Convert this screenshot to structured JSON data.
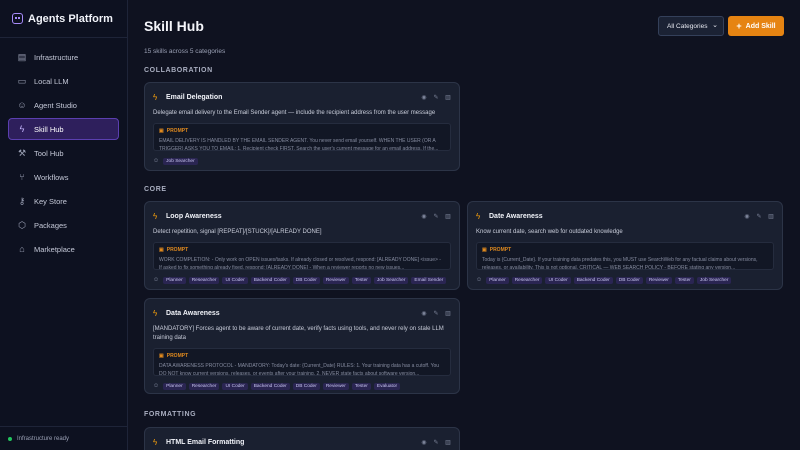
{
  "app": {
    "title": "Agents Platform"
  },
  "sidebar": {
    "items": [
      {
        "label": "Infrastructure",
        "icon": "server-icon"
      },
      {
        "label": "Local LLM",
        "icon": "monitor-icon"
      },
      {
        "label": "Agent Studio",
        "icon": "robot-icon"
      },
      {
        "label": "Skill Hub",
        "icon": "bolt-icon",
        "active": true
      },
      {
        "label": "Tool Hub",
        "icon": "wrench-icon"
      },
      {
        "label": "Workflows",
        "icon": "workflow-icon"
      },
      {
        "label": "Key Store",
        "icon": "key-icon"
      },
      {
        "label": "Packages",
        "icon": "package-icon"
      },
      {
        "label": "Marketplace",
        "icon": "store-icon"
      }
    ],
    "status": "Infrastructure ready",
    "status_color": "#22c55e"
  },
  "page": {
    "title": "Skill Hub",
    "subtitle": "15 skills across 5 categories",
    "filter_value": "All Categories",
    "add_label": "Add Skill",
    "accent": "#e68412"
  },
  "sections": [
    {
      "name": "COLLABORATION"
    },
    {
      "name": "CORE"
    },
    {
      "name": "FORMATTING"
    }
  ],
  "cards": [
    {
      "title": "Email Delegation",
      "description": "Delegate email delivery to the Email Sender agent — include the recipient address from the user message",
      "prompt_label": "PROMPT",
      "prompt": "EMAIL DELIVERY IS HANDLED BY THE EMAIL SENDER AGENT. You never send email yourself. WHEN THE USER (OR A TRIGGER) ASKS YOU TO EMAIL: 1. Recipient check FIRST. Search the user's current message for an email address. If the...",
      "tags": [
        "Job Searcher"
      ]
    },
    {
      "title": "Loop Awareness",
      "description": "Detect repetition, signal [REPEAT]/[STUCK]/[ALREADY DONE]",
      "prompt_label": "PROMPT",
      "prompt": "WORK COMPLETION: - Only work on OPEN issues/tasks. If already closed or resolved, respond: [ALREADY DONE] <issue> - If asked to fix something already fixed, respond: [ALREADY DONE] - When a reviewer reports no new issues...",
      "tags": [
        "Planner",
        "Researcher",
        "UI Coder",
        "Backend Coder",
        "DB Coder",
        "Reviewer",
        "Tester",
        "Job Searcher",
        "Email Sender"
      ]
    },
    {
      "title": "Date Awareness",
      "description": "Know current date, search web for outdated knowledge",
      "prompt_label": "PROMPT",
      "prompt": "Today is {Current_Date}. If your training data predates this, you MUST use SearchWeb for any factual claims about versions, releases, or availability. This is not optional. CRITICAL — WEB SEARCH POLICY - BEFORE stating any version...",
      "tags": [
        "Planner",
        "Researcher",
        "UI Coder",
        "Backend Coder",
        "DB Coder",
        "Reviewer",
        "Tester",
        "Job Searcher"
      ]
    },
    {
      "title": "Data Awareness",
      "description": "[MANDATORY] Forces agent to be aware of current date, verify facts using tools, and never rely on stale LLM training data",
      "prompt_label": "PROMPT",
      "prompt": "DATA AWARENESS PROTOCOL - MANDATORY: Today's date: {Current_Date} RULES: 1. Your training data has a cutoff. You DO NOT know current versions, releases, or events after your training. 2. NEVER state facts about software version...",
      "tags": [
        "Planner",
        "Researcher",
        "UI Coder",
        "Backend Coder",
        "DB Coder",
        "Reviewer",
        "Tester",
        "Evaluator"
      ]
    },
    {
      "title": "HTML Email Formatting",
      "description": "",
      "prompt_label": "",
      "prompt": "",
      "tags": []
    }
  ]
}
